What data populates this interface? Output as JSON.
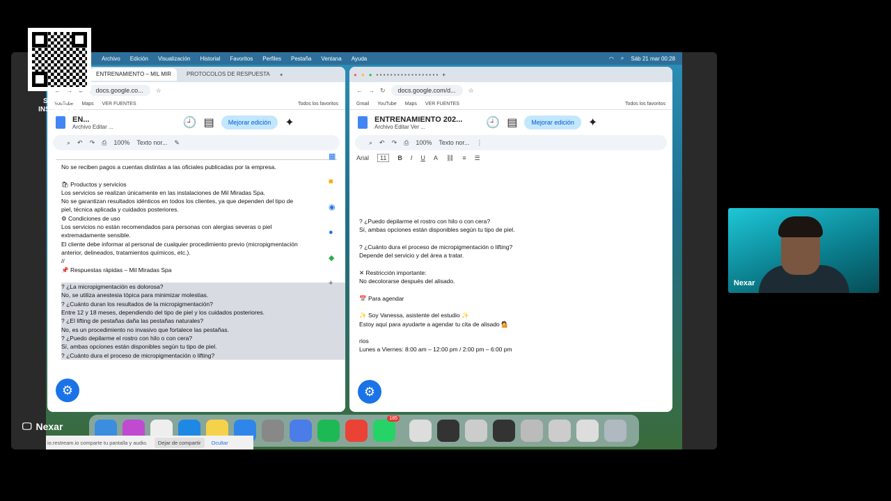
{
  "overlay": {
    "follow_line1": "SÍGUEME",
    "follow_line2": "INSTAGRAM",
    "presenter": "Nexar",
    "cam_name": "Nexar"
  },
  "menubar": {
    "items": [
      "Archivo",
      "Edición",
      "Visualización",
      "Historial",
      "Favoritos",
      "Perfiles",
      "Pestaña",
      "Ventana",
      "Ayuda"
    ],
    "clock": "Sáb 21 mar 00:28"
  },
  "left": {
    "tabs": [
      "ENTRENAMIENTO – MIL MIR",
      "PROTOCOLOS DE RESPUESTA"
    ],
    "url": "docs.google.co...",
    "bookmarks": [
      "YouTube",
      "Maps",
      "VER FUENTES",
      "Todos los favoritos"
    ],
    "doc_title": "EN...",
    "doc_menu": "Archivo  Editar  ...",
    "share": "Mejorar edición",
    "zoom": "100%",
    "style": "Texto nor...",
    "lines": [
      {
        "t": "No se reciben pagos a cuentas distintas a las oficiales publicadas por la empresa.",
        "c": ""
      },
      {
        "t": "",
        "c": ""
      },
      {
        "t": "🛍  Productos y servicios",
        "c": ""
      },
      {
        "t": "Los servicios se realizan únicamente en las instalaciones de Mil Miradas Spa.",
        "c": ""
      },
      {
        "t": "No se garantizan resultados idénticos en todos los clientes, ya que dependen del tipo de",
        "c": ""
      },
      {
        "t": "piel, técnica aplicada y cuidados posteriores.",
        "c": ""
      },
      {
        "t": "⚙  Condiciones de uso",
        "c": ""
      },
      {
        "t": "Los servicios no están recomendados para personas con alergias severas o piel",
        "c": ""
      },
      {
        "t": "extremadamente sensible.",
        "c": ""
      },
      {
        "t": " El cliente debe informar al personal de cualquier procedimiento previo (micropigmentación",
        "c": ""
      },
      {
        "t": "anterior, delineados, tratamientos químicos, etc.).",
        "c": ""
      },
      {
        "t": "//",
        "c": ""
      },
      {
        "t": "📌  Respuestas rápidas – Mil Miradas Spa",
        "c": ""
      },
      {
        "t": "",
        "c": ""
      },
      {
        "t": "?   ¿La micropigmentación es dolorosa?",
        "c": "hl"
      },
      {
        "t": "     No, se utiliza anestesia tópica para minimizar molestias.",
        "c": "hl"
      },
      {
        "t": "?   ¿Cuánto duran los resultados de la micropigmentación?",
        "c": "hl"
      },
      {
        "t": "     Entre 12 y 18 meses, dependiendo del tipo de piel y los cuidados posteriores.",
        "c": "hl"
      },
      {
        "t": "?   ¿El lifting de pestañas daña las pestañas naturales?",
        "c": "hl"
      },
      {
        "t": "     No, es un procedimiento no invasivo que fortalece las pestañas.",
        "c": "hl"
      },
      {
        "t": "?   ¿Puedo depilarme el rostro con hilo o con cera?",
        "c": "hl"
      },
      {
        "t": "     Sí, ambas opciones están disponibles según tu tipo de piel.",
        "c": "hl"
      },
      {
        "t": "?   ¿Cuánto dura el proceso de micropigmentación o lifting?",
        "c": "hl"
      }
    ]
  },
  "right": {
    "url": "docs.google.com/d...",
    "bookmarks": [
      "Gmail",
      "YouTube",
      "Maps",
      "VER FUENTES",
      "Todos los favoritos"
    ],
    "doc_title": "ENTRENAMIENTO 202...",
    "doc_menu": "Archivo  Editar  Ver  ...",
    "share": "Mejorar edición",
    "zoom": "100%",
    "style": "Texto nor...",
    "font": "Arial",
    "size": "11",
    "lines": [
      {
        "t": "?  ¿Puedo depilarme el rostro con hilo o con cera?",
        "c": ""
      },
      {
        "t": "    Sí, ambas opciones están disponibles según tu tipo de piel.",
        "c": ""
      },
      {
        "t": "",
        "c": ""
      },
      {
        "t": "?   ¿Cuánto dura el proceso de micropigmentación o lifting?",
        "c": ""
      },
      {
        "t": "     Depende del servicio y del área a tratar.",
        "c": ""
      },
      {
        "t": "",
        "c": ""
      },
      {
        "t": "✕  Restricción importante:",
        "c": ""
      },
      {
        "t": "No decolorarse después del alisado.",
        "c": ""
      },
      {
        "t": "",
        "c": ""
      },
      {
        "t": "📅  Para agendar",
        "c": ""
      },
      {
        "t": "",
        "c": ""
      },
      {
        "t": "✨  Soy Vanessa, asistente del estudio ✨",
        "c": ""
      },
      {
        "t": "Estoy aquí para ayudarte a agendar tu cita de alisado 💁",
        "c": ""
      },
      {
        "t": "",
        "c": ""
      },
      {
        "t": "        rios",
        "c": ""
      },
      {
        "t": "Lunes a Viernes: 8:00 am – 12:00 pm / 2:00 pm – 6:00 pm",
        "c": ""
      }
    ]
  },
  "sharebar": {
    "text": "io.restream.io comparte tu pantalla y audio.",
    "stop": "Dejar de compartir",
    "hide": "Ocultar"
  },
  "dock": {
    "badge": "185"
  }
}
